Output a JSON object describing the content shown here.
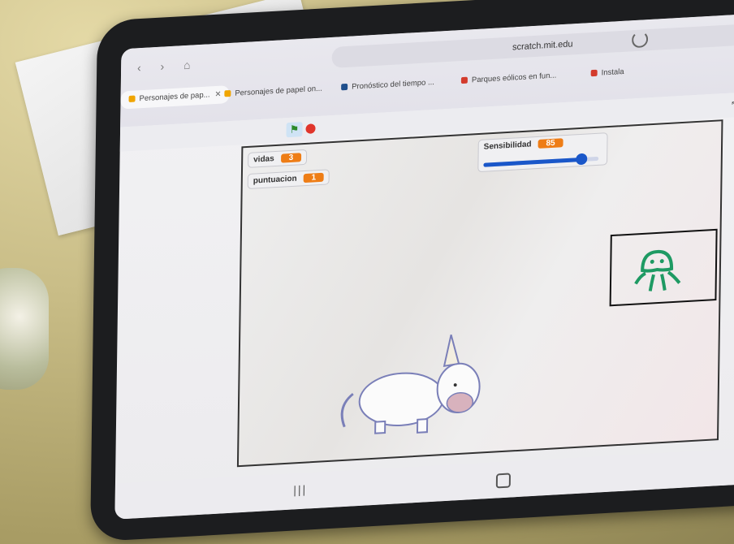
{
  "browser": {
    "url": "scratch.mit.edu",
    "tabs": [
      {
        "label": "Personajes de pap...",
        "color": "#f0a500",
        "active": true
      },
      {
        "label": "Personajes de papel on...",
        "color": "#f0a500"
      },
      {
        "label": "Pronóstico del tiempo ...",
        "color": "#1f4e8c"
      },
      {
        "label": "Parques eólicos en fun...",
        "color": "#d33b2c"
      },
      {
        "label": "Instala",
        "color": "#d33b2c"
      }
    ],
    "tab_close": "✕"
  },
  "stage": {
    "monitors": {
      "vidas": {
        "label": "vidas",
        "value": "3"
      },
      "puntuacion": {
        "label": "puntuacion",
        "value": "1"
      },
      "sensibilidad": {
        "label": "Sensibilidad",
        "value": "85",
        "level": 85
      }
    }
  },
  "icons": {
    "flag": "green-flag-icon",
    "stop": "stop-icon",
    "fullscreen": "exit-fullscreen-icon",
    "reload": "reload-icon",
    "recent_apps": "|||"
  }
}
